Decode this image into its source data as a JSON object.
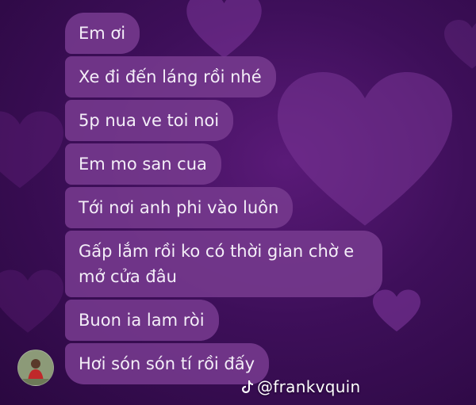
{
  "messages": [
    {
      "text": "Em ơi"
    },
    {
      "text": "Xe đi đến láng rồi nhé"
    },
    {
      "text": "5p nua ve toi noi"
    },
    {
      "text": "Em mo san cua"
    },
    {
      "text": "Tới nơi anh phi vào luôn"
    },
    {
      "text": "Gấp lắm rồi ko có thời gian chờ e mở cửa đâu"
    },
    {
      "text": "Buon ia lam ròi"
    },
    {
      "text": "Hơi són són tí rồi đấy"
    }
  ],
  "watermark": {
    "handle": "@frankvquin",
    "icon": "tiktok-icon"
  },
  "colors": {
    "bubble": "#763a8e",
    "background": "#3e0f5a",
    "heart": "#6a2a8a"
  }
}
